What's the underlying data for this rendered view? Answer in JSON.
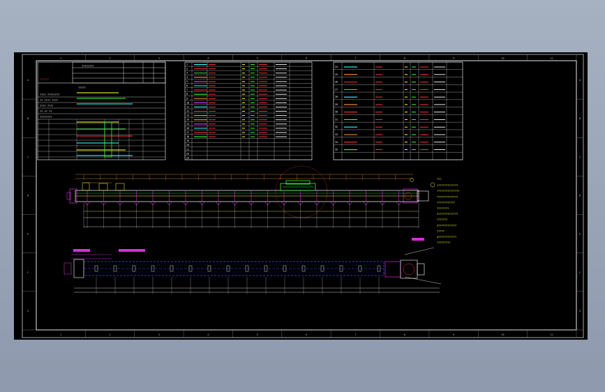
{
  "drawing": {
    "ruler_numbers": [
      "1",
      "2",
      "3",
      "4",
      "5",
      "6",
      "7",
      "8",
      "9",
      "10",
      "11"
    ],
    "row_letters": [
      "A",
      "B",
      "C",
      "D",
      "E",
      "F",
      "G"
    ],
    "colors": {
      "frame": "#ffffff",
      "grid": "#ffffff",
      "text_cn": "#ffffff",
      "accent_red": "#ff3333",
      "accent_green": "#33ff33",
      "accent_yellow": "#ffff33",
      "accent_cyan": "#33ffff",
      "accent_magenta": "#ff33ff",
      "accent_blue": "#3355ff",
      "orange": "#ff9933"
    }
  },
  "title_block": {
    "header": "????????",
    "subtitle": "?????",
    "label_red": "??????",
    "rows": [
      "????  ????????",
      "??  ????  ????",
      "????  ????",
      "??  ??  ??",
      "????????"
    ]
  },
  "parts_list_left": {
    "rows": 23,
    "first_col": [
      "1",
      "2",
      "3",
      "4",
      "5",
      "6",
      "7",
      "8",
      "9",
      "10",
      "11",
      "12",
      "13",
      "14",
      "15",
      "16",
      "17",
      "18",
      "19",
      "20",
      "21",
      "22",
      "23"
    ]
  },
  "parts_list_right": {
    "rows": 12,
    "first_col": [
      "24",
      "25",
      "26",
      "27",
      "28",
      "29",
      "30",
      "31",
      "32",
      "33",
      "34",
      "35"
    ]
  },
  "notes": {
    "heading": "???",
    "lines": [
      "1?????????????",
      "???????????????",
      "??????????????",
      "????????????",
      "????????",
      "2?????????????",
      "???????",
      "3????????????",
      "?????",
      "4????????????",
      "?????????"
    ]
  },
  "views": {
    "front_view": "front-elevation",
    "plan_view": "plan-view"
  }
}
